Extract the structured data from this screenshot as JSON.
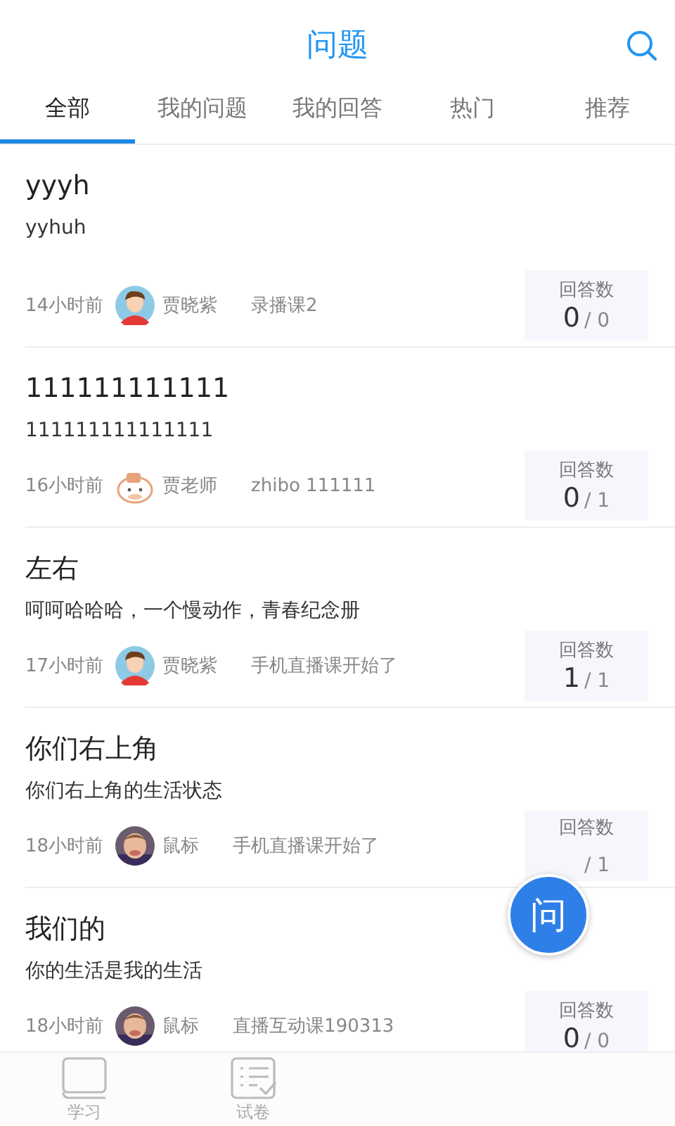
{
  "header": {
    "title": "问题"
  },
  "tabs": [
    {
      "label": "全部",
      "selected": true
    },
    {
      "label": "我的问题",
      "selected": false
    },
    {
      "label": "我的回答",
      "selected": false
    },
    {
      "label": "热门",
      "selected": false
    },
    {
      "label": "推荐",
      "selected": false
    }
  ],
  "questions": [
    {
      "title": "yyyh",
      "body": "yyhuh",
      "time": "14小时前",
      "author": "贾晓紫",
      "avatar": {
        "kind": "boy"
      },
      "course": "录播课2",
      "answers_label": "回答数",
      "answered": "0",
      "total": "/ 0"
    },
    {
      "title": "111111111111",
      "body": "111111111111111",
      "time": "16小时前",
      "author": "贾老师",
      "avatar": {
        "kind": "cartoon"
      },
      "course": "zhibo 111111",
      "answers_label": "回答数",
      "answered": "0",
      "total": "/ 1"
    },
    {
      "title": "左右",
      "body": "呵呵哈哈哈，一个慢动作，青春纪念册",
      "time": "17小时前",
      "author": "贾晓紫",
      "avatar": {
        "kind": "boy"
      },
      "course": "手机直播课开始了",
      "answers_label": "回答数",
      "answered": "1",
      "total": "/ 1"
    },
    {
      "title": "你们右上角",
      "body": "你们右上角的生活状态",
      "time": "18小时前",
      "author": "鼠标",
      "course": "手机直播课开始了",
      "answers_label": "回答数",
      "total": "/ 1"
    },
    {
      "title": "我们的",
      "body": "你的生活是我的生活",
      "time": "18小时前",
      "author": "鼠标",
      "course": "直播互动课190313",
      "answers_label": "回答数",
      "answered": "0",
      "total": "/ 0"
    }
  ],
  "ask_button": {
    "label": "问"
  },
  "bottom_nav": [
    {
      "label": "学习",
      "kind": "book"
    },
    {
      "label": "试卷",
      "kind": "list"
    }
  ]
}
